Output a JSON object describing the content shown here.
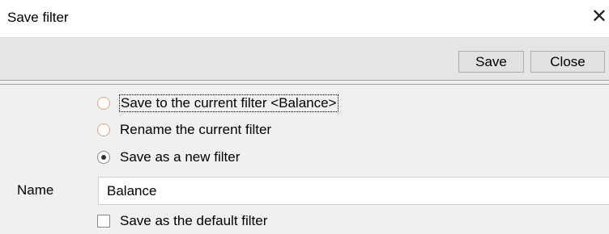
{
  "window": {
    "title": "Save filter",
    "close_glyph": "✕"
  },
  "toolbar": {
    "save_label": "Save",
    "close_label": "Close"
  },
  "options": {
    "save_current": "Save to the current filter <Balance>",
    "rename_current": "Rename the current filter",
    "save_new": "Save as a new filter",
    "selected": "save_new"
  },
  "name_field": {
    "label": "Name",
    "value": "Balance"
  },
  "default_checkbox": {
    "label": "Save as the default filter",
    "checked": false
  },
  "colors": {
    "radio_unchecked_border": "#d6a78a",
    "background": "#f0f0f0",
    "toolbar": "#e5e5e5"
  }
}
